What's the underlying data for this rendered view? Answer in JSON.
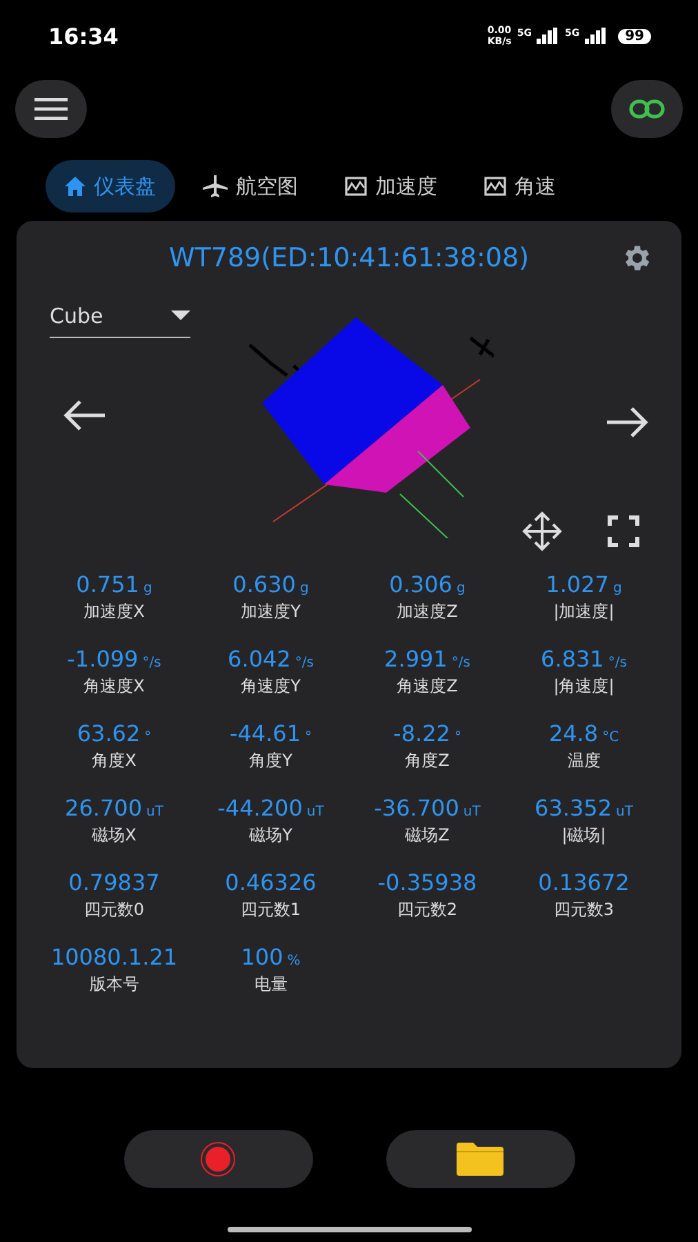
{
  "status_bar": {
    "time": "16:34",
    "net_speed": "0.00",
    "net_unit": "KB/s",
    "sim_1": "5G",
    "sim_2": "5G",
    "battery": "99"
  },
  "tabs": [
    {
      "label": "仪表盘",
      "kind": "home",
      "selected": true
    },
    {
      "label": "航空图",
      "kind": "plane",
      "selected": false
    },
    {
      "label": "加速度",
      "kind": "chart",
      "selected": false
    },
    {
      "label": "角速",
      "kind": "chart",
      "selected": false
    }
  ],
  "device": {
    "title": "WT789(ED:10:41:61:38:08)",
    "model_select": "Cube"
  },
  "readings": [
    {
      "value": "0.751",
      "unit": "g",
      "label": "加速度X"
    },
    {
      "value": "0.630",
      "unit": "g",
      "label": "加速度Y"
    },
    {
      "value": "0.306",
      "unit": "g",
      "label": "加速度Z"
    },
    {
      "value": "1.027",
      "unit": "g",
      "label": "|加速度|"
    },
    {
      "value": "-1.099",
      "unit": "°/s",
      "label": "角速度X"
    },
    {
      "value": "6.042",
      "unit": "°/s",
      "label": "角速度Y"
    },
    {
      "value": "2.991",
      "unit": "°/s",
      "label": "角速度Z"
    },
    {
      "value": "6.831",
      "unit": "°/s",
      "label": "|角速度|"
    },
    {
      "value": "63.62",
      "unit": "°",
      "label": "角度X"
    },
    {
      "value": "-44.61",
      "unit": "°",
      "label": "角度Y"
    },
    {
      "value": "-8.22",
      "unit": "°",
      "label": "角度Z"
    },
    {
      "value": "24.8",
      "unit": "°C",
      "label": "温度"
    },
    {
      "value": "26.700",
      "unit": "uT",
      "label": "磁场X"
    },
    {
      "value": "-44.200",
      "unit": "uT",
      "label": "磁场Y"
    },
    {
      "value": "-36.700",
      "unit": "uT",
      "label": "磁场Z"
    },
    {
      "value": "63.352",
      "unit": "uT",
      "label": "|磁场|"
    },
    {
      "value": "0.79837",
      "label": "四元数0"
    },
    {
      "value": "0.46326",
      "label": "四元数1"
    },
    {
      "value": "-0.35938",
      "label": "四元数2"
    },
    {
      "value": "0.13672",
      "label": "四元数3"
    },
    {
      "value": "10080.1.21",
      "label": "版本号"
    },
    {
      "value": "100",
      "unit": "%",
      "label": "电量"
    }
  ]
}
